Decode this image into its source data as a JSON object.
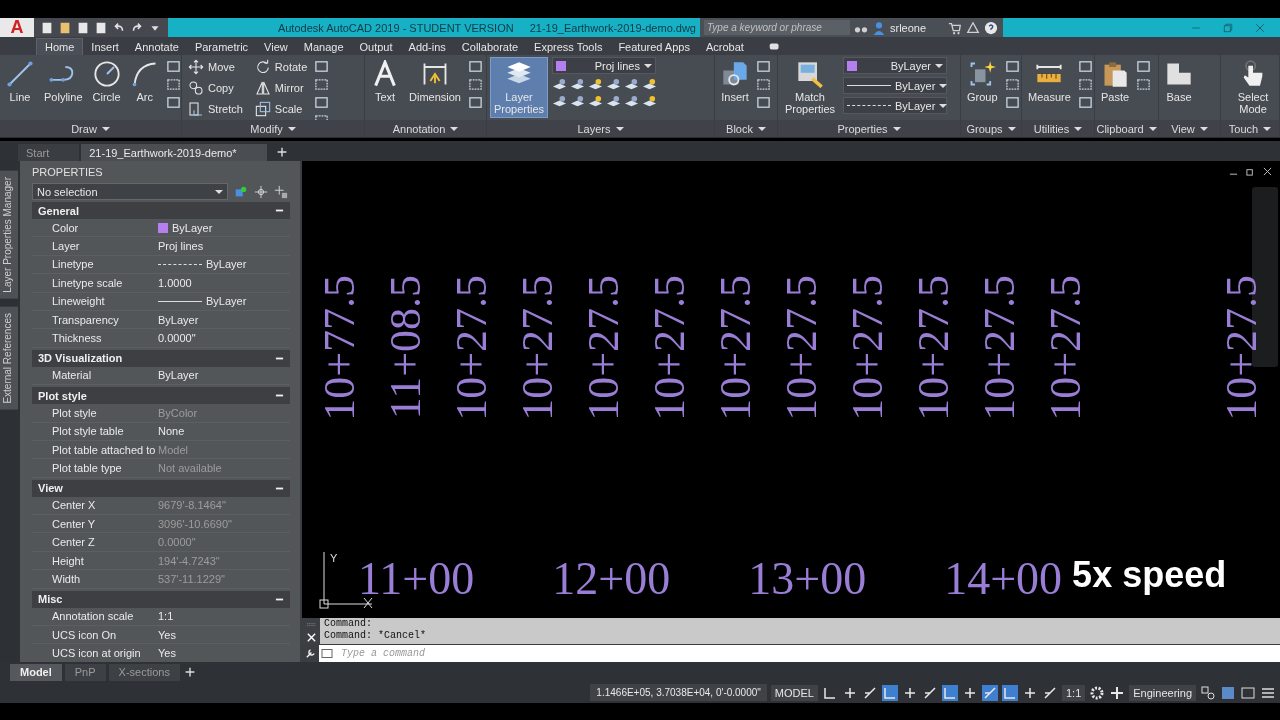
{
  "title_bar": {
    "app_letter": "A",
    "app_title": "Autodesk AutoCAD 2019 - STUDENT VERSION",
    "file_name": "21-19_Earthwork-2019-demo.dwg",
    "search_placeholder": "Type a keyword or phrase",
    "user": "srleone"
  },
  "menu_tabs": [
    {
      "label": "Home",
      "selected": true
    },
    {
      "label": "Insert",
      "selected": false
    },
    {
      "label": "Annotate",
      "selected": false
    },
    {
      "label": "Parametric",
      "selected": false
    },
    {
      "label": "View",
      "selected": false
    },
    {
      "label": "Manage",
      "selected": false
    },
    {
      "label": "Output",
      "selected": false
    },
    {
      "label": "Add-ins",
      "selected": false
    },
    {
      "label": "Collaborate",
      "selected": false
    },
    {
      "label": "Express Tools",
      "selected": false
    },
    {
      "label": "Featured Apps",
      "selected": false
    },
    {
      "label": "Acrobat",
      "selected": false
    }
  ],
  "ribbon": {
    "panels": [
      {
        "title": "Draw",
        "kind": "large",
        "tools": [
          {
            "label": "Line",
            "selected": false
          },
          {
            "label": "Polyline",
            "selected": false
          },
          {
            "label": "Circle",
            "selected": false
          },
          {
            "label": "Arc",
            "selected": false
          }
        ]
      },
      {
        "title": "Modify",
        "kind": "small",
        "tools": [
          {
            "label": "Move",
            "selected": false
          },
          {
            "label": "Rotate",
            "selected": false
          },
          {
            "label": "Copy",
            "selected": false
          },
          {
            "label": "Mirror",
            "selected": false
          },
          {
            "label": "Stretch",
            "selected": false
          },
          {
            "label": "Scale",
            "selected": false
          }
        ]
      },
      {
        "title": "Annotation",
        "kind": "large",
        "tools": [
          {
            "label": "Text",
            "selected": false
          },
          {
            "label": "Dimension",
            "selected": false
          }
        ]
      },
      {
        "title": "Layers",
        "kind": "large",
        "tools": [
          {
            "label": "Layer Properties",
            "selected": true
          }
        ],
        "dropdowns": [
          {
            "value": "Proj lines",
            "kind": "color",
            "color": "#b57ff0"
          }
        ]
      },
      {
        "title": "Block",
        "kind": "large",
        "tools": [
          {
            "label": "Insert",
            "selected": false
          }
        ]
      },
      {
        "title": "Properties",
        "kind": "large",
        "tools": [
          {
            "label": "Match Properties",
            "selected": false
          }
        ],
        "dropdowns": [
          {
            "value": "ByLayer",
            "kind": "color",
            "color": "#b57ff0"
          },
          {
            "value": "ByLayer",
            "kind": "solid"
          },
          {
            "value": "ByLayer",
            "kind": "dashed"
          }
        ]
      },
      {
        "title": "Groups",
        "kind": "large",
        "tools": [
          {
            "label": "Group",
            "selected": false
          }
        ]
      },
      {
        "title": "Utilities",
        "kind": "large",
        "tools": [
          {
            "label": "Measure",
            "selected": false
          }
        ]
      },
      {
        "title": "Clipboard",
        "kind": "large",
        "tools": [
          {
            "label": "Paste",
            "selected": false
          }
        ]
      },
      {
        "title": "View",
        "kind": "large",
        "tools": [
          {
            "label": "Base",
            "selected": false
          }
        ]
      },
      {
        "title": "Touch",
        "kind": "large",
        "tools": [
          {
            "label": "Select Mode",
            "selected": false
          }
        ]
      }
    ]
  },
  "file_tabs": [
    {
      "label": "Start",
      "selected": false
    },
    {
      "label": "21-19_Earthwork-2019-demo*",
      "selected": true
    }
  ],
  "side_tabs": [
    "Layer Properties Manager",
    "External References"
  ],
  "properties": {
    "title": "PROPERTIES",
    "selection": "No selection",
    "sections": [
      {
        "title": "General",
        "expanded": true,
        "rows": [
          {
            "name": "Color",
            "value": "ByLayer",
            "kind": "color",
            "color": "#b57ff0",
            "disabled": false
          },
          {
            "name": "Layer",
            "value": "Proj lines",
            "kind": "text",
            "disabled": false
          },
          {
            "name": "Linetype",
            "value": "ByLayer",
            "kind": "dashed",
            "disabled": false
          },
          {
            "name": "Linetype scale",
            "value": "1.0000",
            "kind": "text",
            "disabled": false
          },
          {
            "name": "Lineweight",
            "value": "ByLayer",
            "kind": "solid",
            "disabled": false
          },
          {
            "name": "Transparency",
            "value": "ByLayer",
            "kind": "text",
            "disabled": false
          },
          {
            "name": "Thickness",
            "value": "0.0000\"",
            "kind": "text",
            "disabled": false
          }
        ]
      },
      {
        "title": "3D Visualization",
        "expanded": true,
        "rows": [
          {
            "name": "Material",
            "value": "ByLayer",
            "kind": "text",
            "disabled": false
          }
        ]
      },
      {
        "title": "Plot style",
        "expanded": true,
        "rows": [
          {
            "name": "Plot style",
            "value": "ByColor",
            "kind": "text",
            "disabled": true
          },
          {
            "name": "Plot style table",
            "value": "None",
            "kind": "text",
            "disabled": false
          },
          {
            "name": "Plot table attached to",
            "value": "Model",
            "kind": "text",
            "disabled": true
          },
          {
            "name": "Plot table type",
            "value": "Not available",
            "kind": "text",
            "disabled": true
          }
        ]
      },
      {
        "title": "View",
        "expanded": true,
        "rows": [
          {
            "name": "Center X",
            "value": "9679'-8.1464\"",
            "kind": "text",
            "disabled": true
          },
          {
            "name": "Center Y",
            "value": "3096'-10.6690\"",
            "kind": "text",
            "disabled": true
          },
          {
            "name": "Center Z",
            "value": "0.0000\"",
            "kind": "text",
            "disabled": true
          },
          {
            "name": "Height",
            "value": "194'-4.7243\"",
            "kind": "text",
            "disabled": true
          },
          {
            "name": "Width",
            "value": "537'-11.1229\"",
            "kind": "text",
            "disabled": true
          }
        ]
      },
      {
        "title": "Misc",
        "expanded": true,
        "rows": [
          {
            "name": "Annotation scale",
            "value": "1:1",
            "kind": "text",
            "disabled": false
          },
          {
            "name": "UCS icon On",
            "value": "Yes",
            "kind": "text",
            "disabled": false
          },
          {
            "name": "UCS icon at origin",
            "value": "Yes",
            "kind": "text",
            "disabled": false
          }
        ]
      }
    ]
  },
  "canvas": {
    "station_labels": [
      "10+77.5",
      "11+08.5",
      "10+27.5",
      "10+27.5",
      "10+27.5",
      "10+27.5",
      "10+27.5",
      "10+27.5",
      "10+27.5",
      "10+27.5",
      "10+27.5",
      "10+27.5",
      "10+27.5"
    ],
    "grid_labels": [
      "11+00",
      "12+00",
      "13+00",
      "14+00"
    ],
    "ucs_label": "Y",
    "overlay_text": "5x speed"
  },
  "command": {
    "history": [
      "Command:",
      "Command: *Cancel*"
    ],
    "placeholder": "Type a command"
  },
  "layout_tabs": [
    {
      "label": "Model",
      "selected": true
    },
    {
      "label": "PnP",
      "selected": false
    },
    {
      "label": "X-sections",
      "selected": false
    }
  ],
  "status_bar": {
    "coordinates": "1.1466E+05, 3.7038E+04, 0'-0.0000\"",
    "space": "MODEL",
    "scale": "1:1",
    "workspace": "Engineering",
    "toggles": [
      {
        "on": false
      },
      {
        "on": false
      },
      {
        "on": false
      },
      {
        "on": true
      },
      {
        "on": false
      },
      {
        "on": false
      },
      {
        "on": true
      },
      {
        "on": false
      },
      {
        "on": true
      },
      {
        "on": true
      },
      {
        "on": false
      },
      {
        "on": false
      }
    ]
  }
}
